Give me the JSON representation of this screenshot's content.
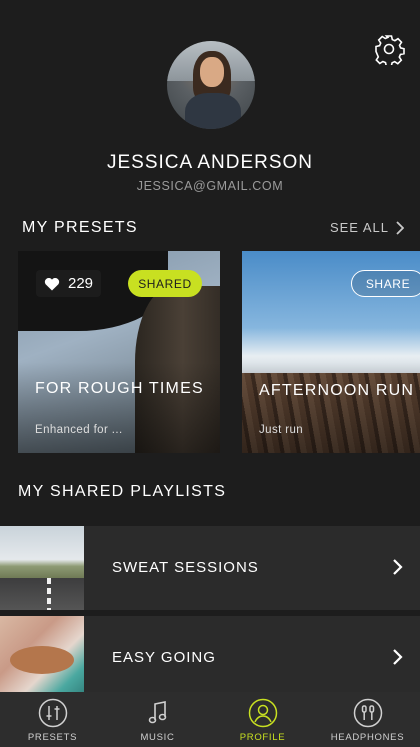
{
  "profile": {
    "name": "JESSICA ANDERSON",
    "email": "JESSICA@GMAIL.COM"
  },
  "presets": {
    "title": "MY PRESETS",
    "see_all": "SEE ALL",
    "cards": [
      {
        "likes": "229",
        "badge": "SHARED",
        "title": "FOR ROUGH TIMES",
        "subtitle": "Enhanced for ..."
      },
      {
        "button": "SHARE",
        "title": "AFTERNOON RUN",
        "subtitle": "Just run"
      }
    ]
  },
  "playlists": {
    "title": "MY SHARED PLAYLISTS",
    "items": [
      {
        "label": "SWEAT SESSIONS"
      },
      {
        "label": "EASY GOING"
      }
    ]
  },
  "tabs": [
    {
      "label": "PRESETS",
      "icon": "sliders-icon"
    },
    {
      "label": "MUSIC",
      "icon": "music-note-icon"
    },
    {
      "label": "PROFILE",
      "icon": "user-icon",
      "active": true
    },
    {
      "label": "HEADPHONES",
      "icon": "earphones-icon"
    }
  ],
  "colors": {
    "accent": "#c8e021",
    "background": "#1d1d1d",
    "row": "#2b2b2b",
    "tabbar": "#2d2d2d"
  }
}
